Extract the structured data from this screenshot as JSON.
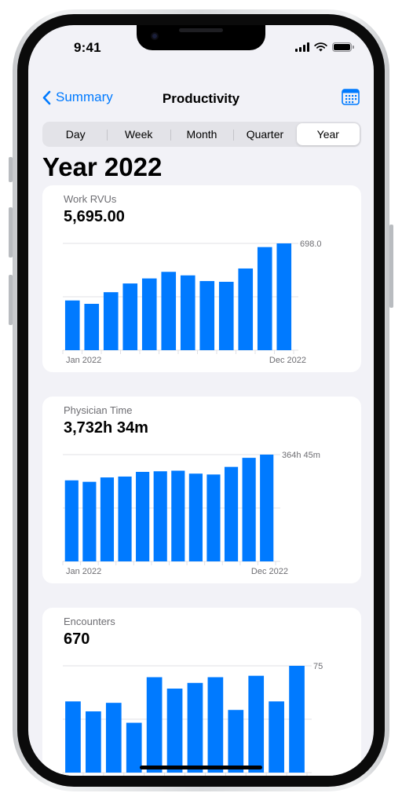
{
  "status_bar": {
    "time": "9:41"
  },
  "nav": {
    "back_label": "Summary",
    "title": "Productivity"
  },
  "segments": [
    {
      "label": "Day",
      "active": false
    },
    {
      "label": "Week",
      "active": false
    },
    {
      "label": "Month",
      "active": false
    },
    {
      "label": "Quarter",
      "active": false
    },
    {
      "label": "Year",
      "active": true
    }
  ],
  "page_title": "Year 2022",
  "colors": {
    "accent": "#007aff",
    "bar": "#007aff",
    "background": "#f2f2f7",
    "card": "#ffffff"
  },
  "cards": [
    {
      "label": "Work RVUs",
      "value": "5,695.00"
    },
    {
      "label": "Physician Time",
      "value": "3,732h 34m"
    },
    {
      "label": "Encounters",
      "value": "670"
    }
  ],
  "chart_data": [
    {
      "type": "bar",
      "categories": [
        "Jan 2022",
        "Feb 2022",
        "Mar 2022",
        "Apr 2022",
        "May 2022",
        "Jun 2022",
        "Jul 2022",
        "Aug 2022",
        "Sep 2022",
        "Oct 2022",
        "Nov 2022",
        "Dec 2022"
      ],
      "values": [
        325,
        303,
        379,
        436,
        469,
        512,
        489,
        452,
        447,
        534,
        674,
        698
      ],
      "ylim": [
        0,
        698
      ],
      "y_tick_labels": [
        "698.0"
      ],
      "x_tick_labels": [
        "Jan 2022",
        "Dec 2022"
      ],
      "grid": true
    },
    {
      "type": "bar",
      "categories": [
        "Jan 2022",
        "Feb 2022",
        "Mar 2022",
        "Apr 2022",
        "May 2022",
        "Jun 2022",
        "Jul 2022",
        "Aug 2022",
        "Sep 2022",
        "Oct 2022",
        "Nov 2022",
        "Dec 2022"
      ],
      "values": [
        277,
        272,
        287,
        290,
        306,
        308,
        310,
        300,
        297,
        323,
        354,
        365
      ],
      "ylim": [
        0,
        365
      ],
      "y_tick_labels": [
        "364h 45m"
      ],
      "x_tick_labels": [
        "Jan 2022",
        "Dec 2022"
      ],
      "grid": true
    },
    {
      "type": "bar",
      "categories": [
        "Jan 2022",
        "Feb 2022",
        "Mar 2022",
        "Apr 2022",
        "May 2022",
        "Jun 2022",
        "Jul 2022",
        "Aug 2022",
        "Sep 2022",
        "Oct 2022",
        "Nov 2022",
        "Dec 2022"
      ],
      "values": [
        50,
        43,
        49,
        35,
        67,
        59,
        63,
        67,
        44,
        68,
        50,
        75
      ],
      "ylim": [
        0,
        75
      ],
      "y_tick_labels": [
        "75"
      ],
      "x_tick_labels": [
        "Jan 2022",
        "Dec 2022"
      ],
      "grid": true
    }
  ]
}
